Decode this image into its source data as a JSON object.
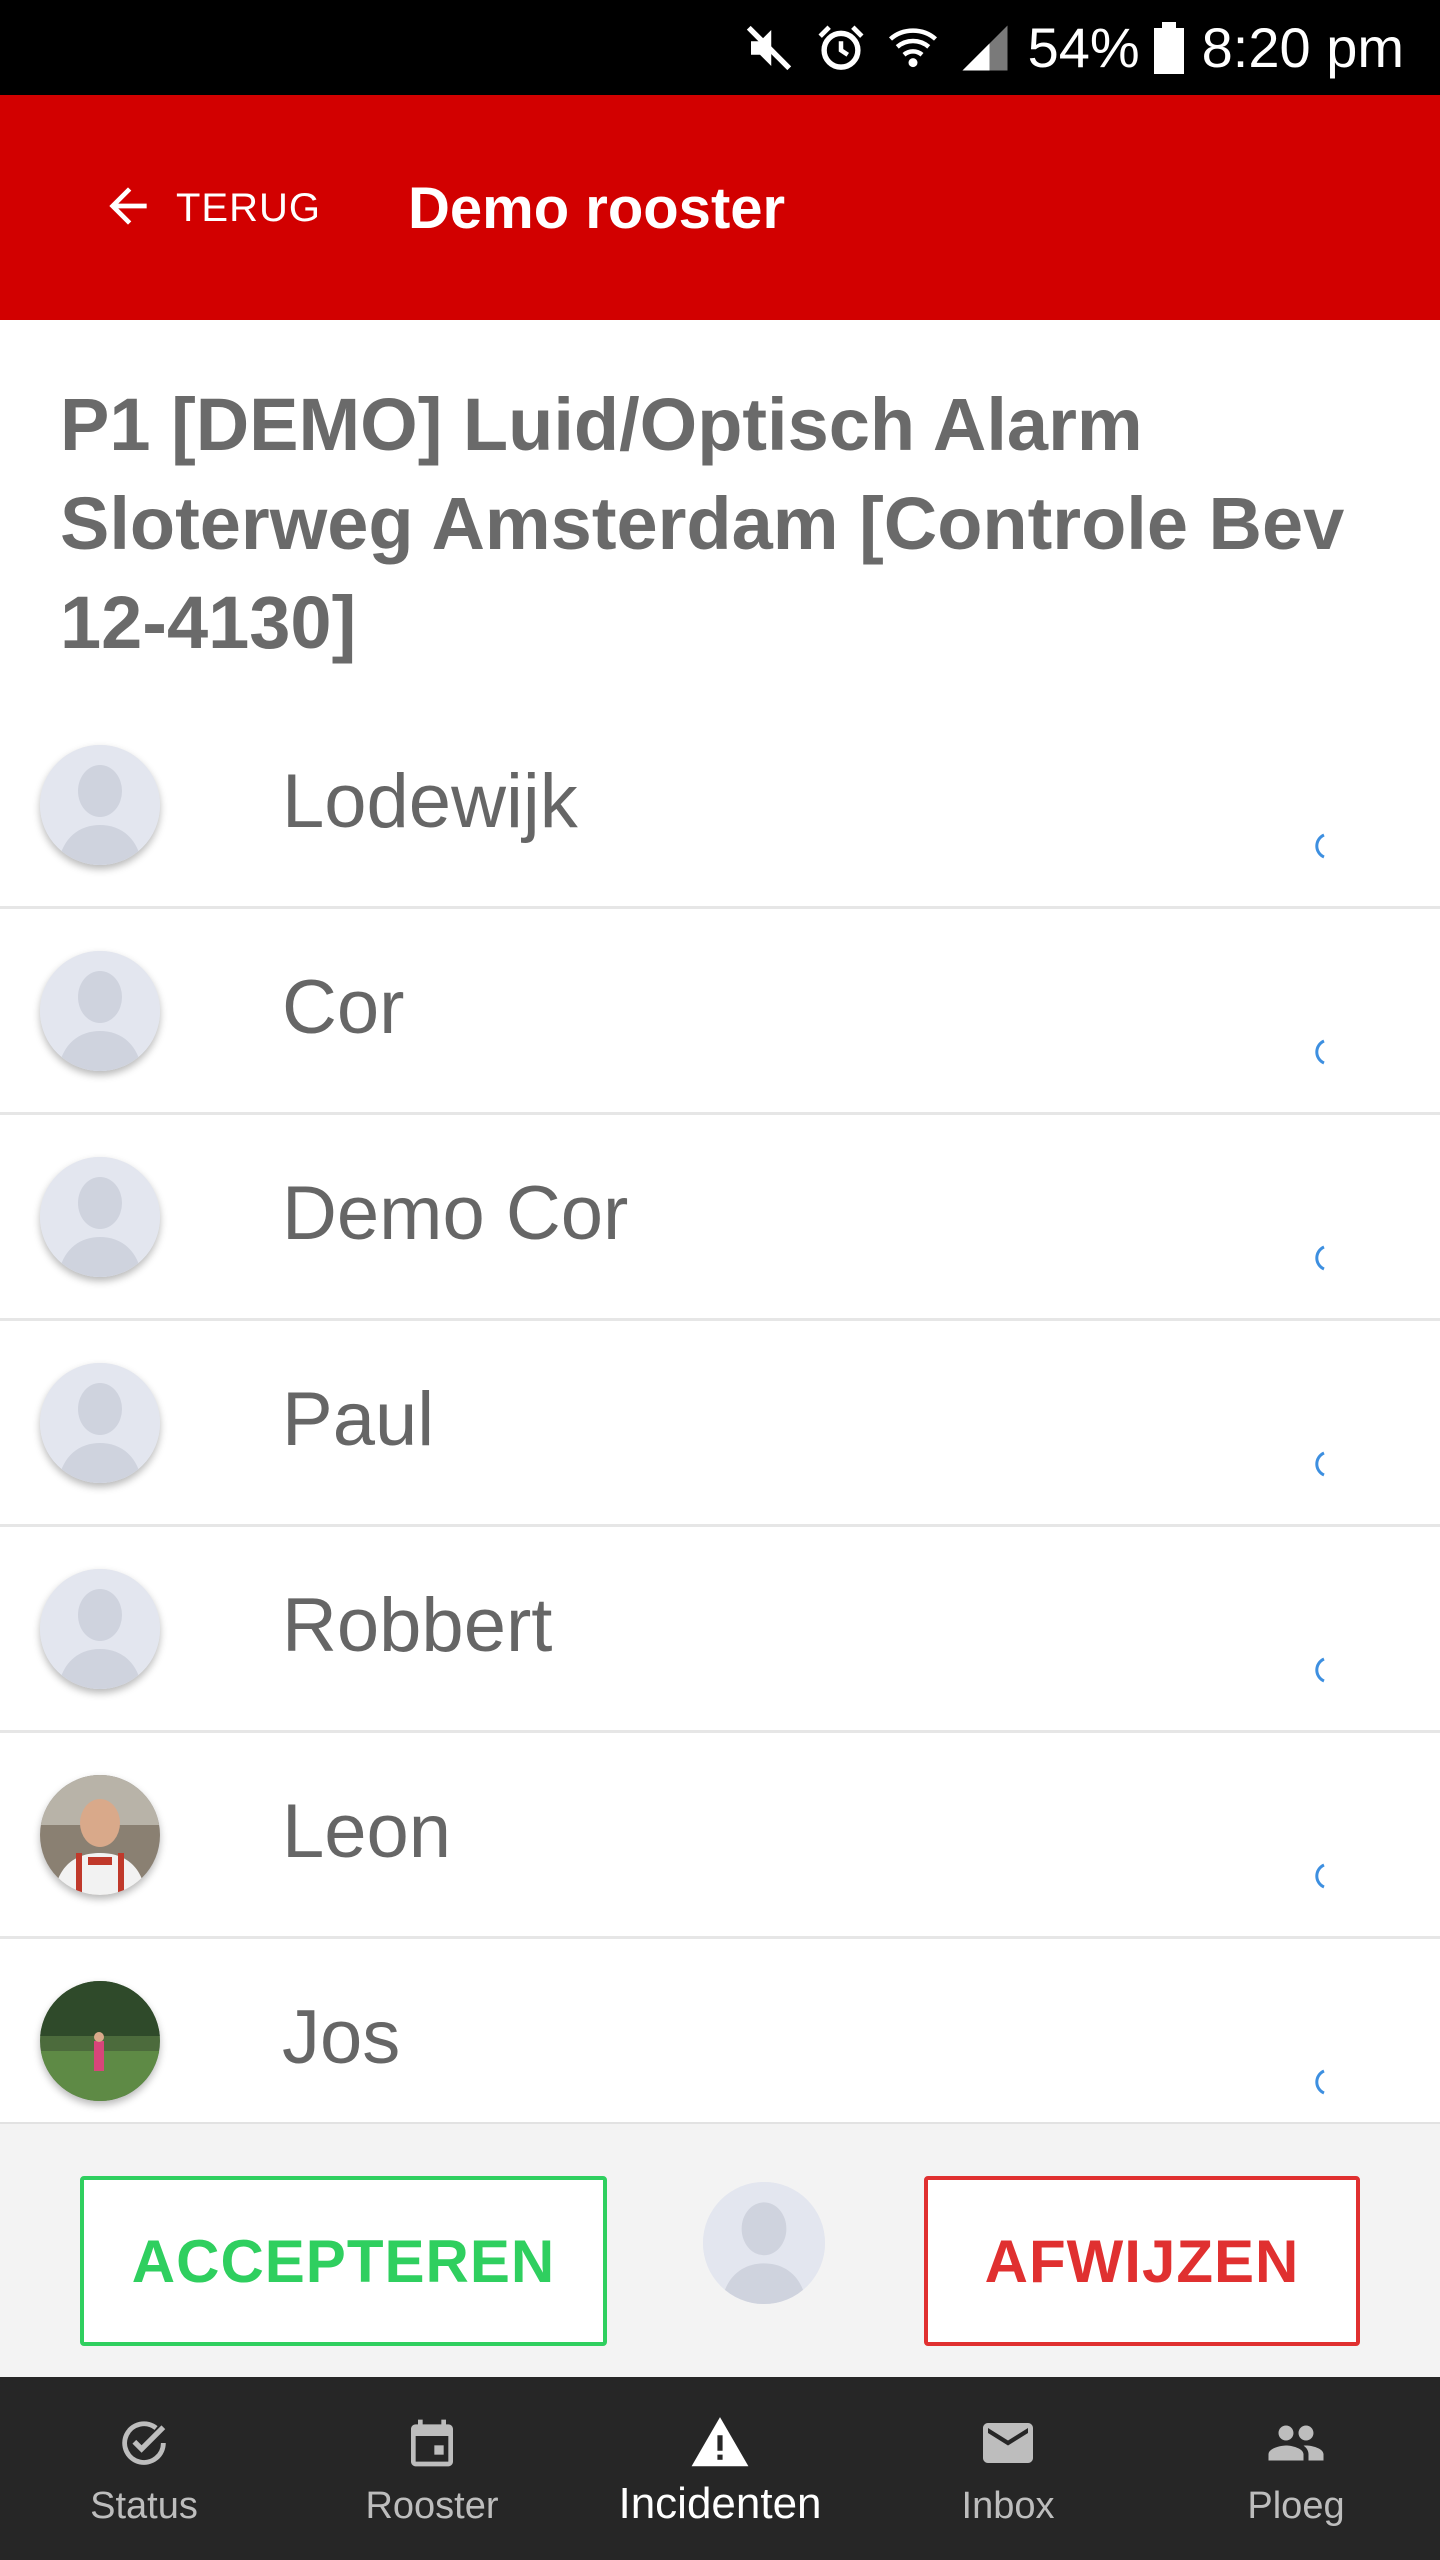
{
  "status_bar": {
    "battery": "54%",
    "time": "8:20 pm",
    "icons": [
      "mute-icon",
      "alarm-icon",
      "wifi-icon",
      "signal-icon",
      "battery-icon"
    ]
  },
  "header": {
    "back_label": "TERUG",
    "title": "Demo rooster",
    "background": "#d20000"
  },
  "incident": {
    "title": "P1 [DEMO] Luid/Optisch Alarm Sloterweg Amsterdam [Controle Bev 12-4130]"
  },
  "people": [
    {
      "name": "Lodewijk",
      "avatar": "placeholder"
    },
    {
      "name": "Cor",
      "avatar": "placeholder"
    },
    {
      "name": "Demo Cor",
      "avatar": "placeholder"
    },
    {
      "name": "Paul",
      "avatar": "placeholder"
    },
    {
      "name": "Robbert",
      "avatar": "placeholder"
    },
    {
      "name": "Leon",
      "avatar": "photo"
    },
    {
      "name": "Jos",
      "avatar": "photo"
    }
  ],
  "actions": {
    "accept_label": "ACCEPTEREN",
    "reject_label": "AFWIJZEN",
    "accept_color": "#2fcf5f",
    "reject_color": "#e03030"
  },
  "nav": {
    "items": [
      {
        "label": "Status",
        "icon": "check-circle-icon"
      },
      {
        "label": "Rooster",
        "icon": "calendar-icon"
      },
      {
        "label": "Incidenten",
        "icon": "warning-icon",
        "active": true
      },
      {
        "label": "Inbox",
        "icon": "mail-icon"
      },
      {
        "label": "Ploeg",
        "icon": "people-icon"
      }
    ]
  }
}
